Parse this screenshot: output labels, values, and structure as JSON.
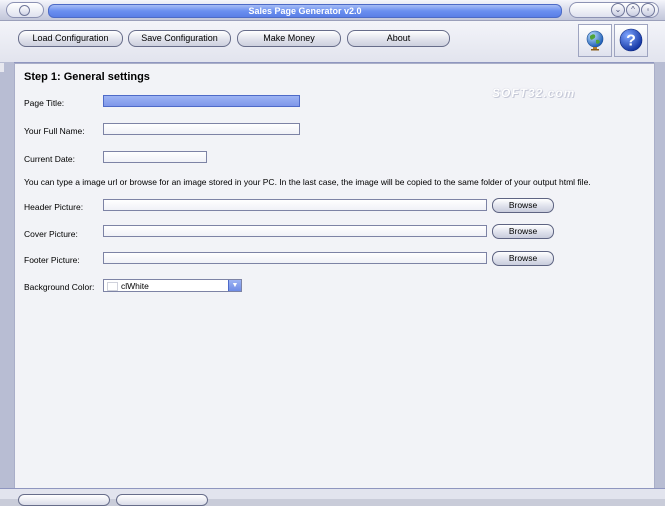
{
  "window": {
    "title": "Sales Page Generator v2.0",
    "controls": [
      "minimize",
      "maximize",
      "close"
    ]
  },
  "toolbar": {
    "buttons": [
      {
        "label": "Load Configuration"
      },
      {
        "label": "Save Configuration"
      },
      {
        "label": "Make Money"
      },
      {
        "label": "About"
      }
    ],
    "icons": [
      "globe-icon",
      "help-icon"
    ]
  },
  "step": {
    "title": "Step 1: General settings"
  },
  "watermark": "SOFT32.com",
  "fields": {
    "page_title": {
      "label": "Page Title:",
      "value": ""
    },
    "full_name": {
      "label": "Your Full Name:",
      "value": ""
    },
    "current_date": {
      "label": "Current Date:",
      "value": ""
    }
  },
  "info_text": "You can type a image url or browse for an image stored in your PC. In the last case, the image will be copied to the same folder of your output html file.",
  "pictures": {
    "header": {
      "label": "Header Picture:",
      "value": "",
      "browse": "Browse"
    },
    "cover": {
      "label": "Cover Picture:",
      "value": "",
      "browse": "Browse"
    },
    "footer": {
      "label": "Footer Picture:",
      "value": "",
      "browse": "Browse"
    }
  },
  "background_color": {
    "label": "Background Color:",
    "selected": "clWhite",
    "swatch": "#ffffff"
  },
  "colors": {
    "accent": "#7e97ea",
    "frame": "#b8bdd3",
    "panel": "#f2f3f7"
  }
}
